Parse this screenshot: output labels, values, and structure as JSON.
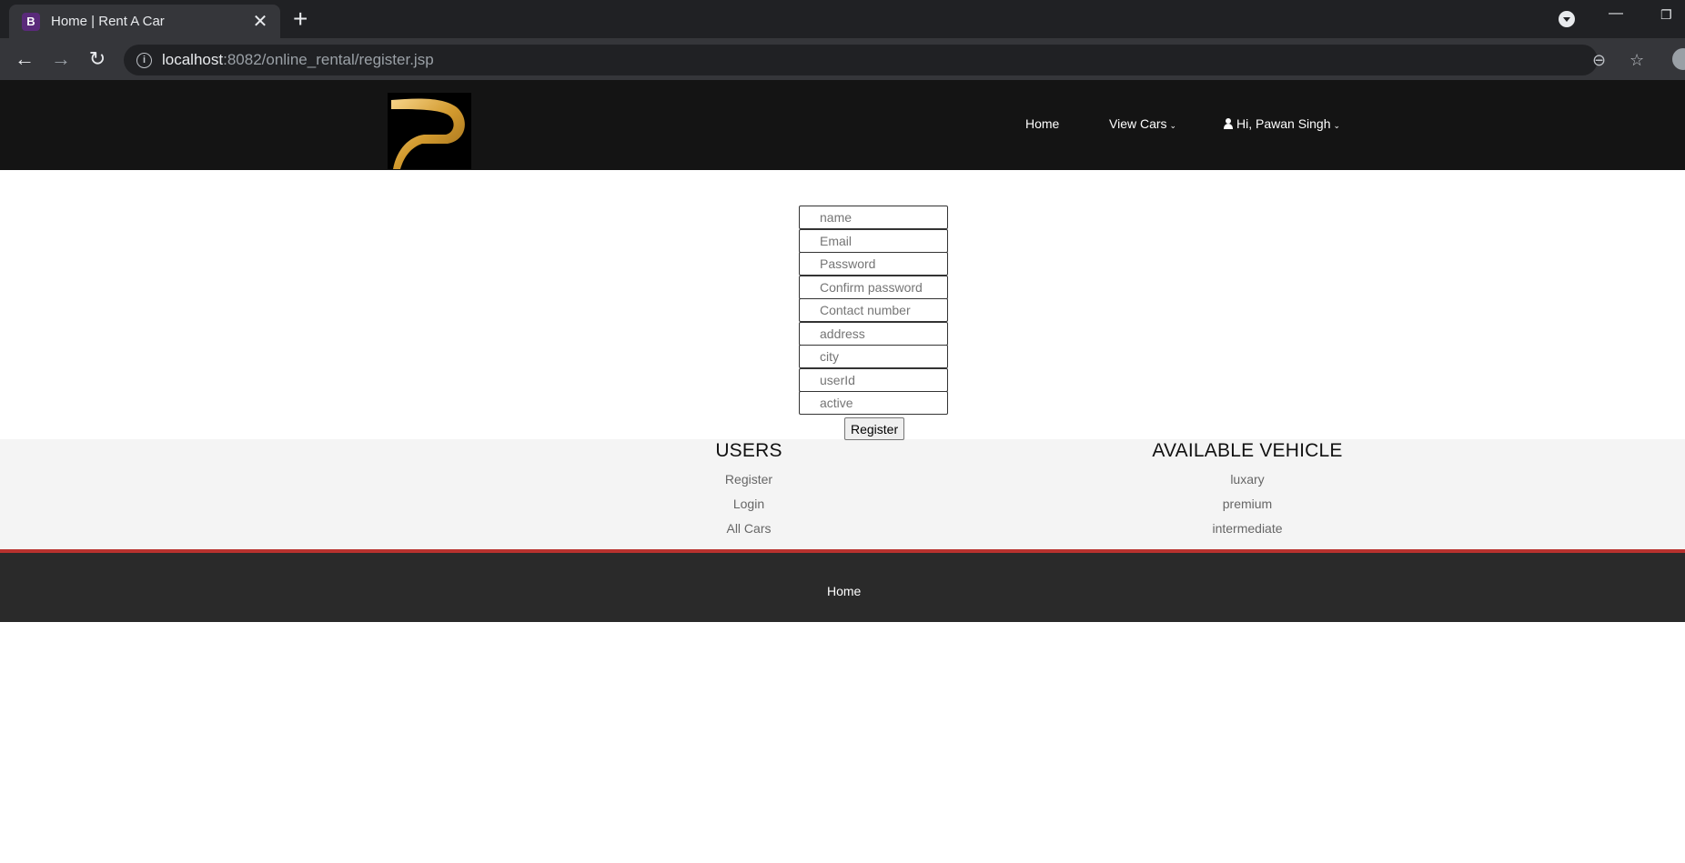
{
  "browser": {
    "tab_title": "Home | Rent A Car",
    "tab_favicon_letter": "B",
    "url_host": "localhost",
    "url_path": ":8082/online_rental/register.jsp",
    "icons": [
      "back-icon",
      "forward-icon",
      "reload-icon",
      "info-icon",
      "zoom-icon",
      "star-icon",
      "new-tab-icon",
      "close-icon",
      "minimize-icon",
      "restore-icon"
    ]
  },
  "header": {
    "logo_letter": "P",
    "nav": {
      "home": "Home",
      "view_cars": "View Cars",
      "user": "Hi, Pawan Singh"
    }
  },
  "form": {
    "placeholders": {
      "name": "name",
      "email": "Email",
      "password": "Password",
      "confirm_password": "Confirm password",
      "contact": "Contact number",
      "address": "address",
      "city": "city",
      "userid": "userId",
      "active": "active"
    },
    "submit_label": "Register"
  },
  "footer": {
    "users": {
      "heading": "USERS",
      "links": [
        "Register",
        "Login",
        "All Cars"
      ]
    },
    "vehicles": {
      "heading": "AVAILABLE VEHICLE",
      "links": [
        "luxary",
        "premium",
        "intermediate"
      ]
    },
    "bottom_link": "Home"
  }
}
